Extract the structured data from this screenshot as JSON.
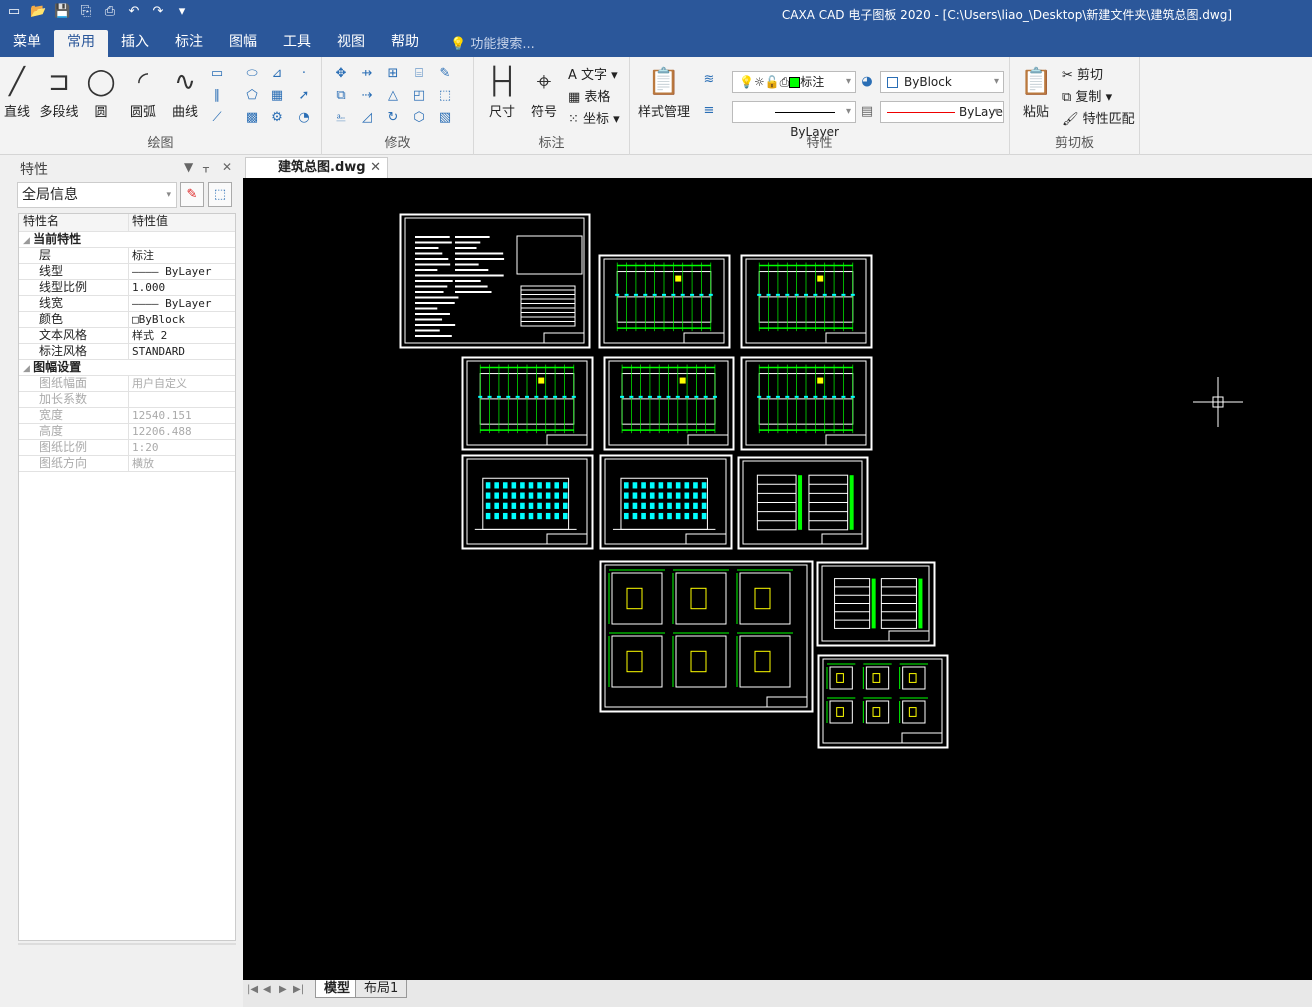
{
  "window": {
    "title": "CAXA CAD 电子图板 2020 - [C:\\Users\\liao_\\Desktop\\新建文件夹\\建筑总图.dwg]"
  },
  "quick_access": [
    "new-icon",
    "open-icon",
    "save-icon",
    "save-as-icon",
    "print-icon",
    "undo-icon",
    "redo-icon",
    "customize-icon"
  ],
  "menu_tabs": [
    "菜单",
    "常用",
    "插入",
    "标注",
    "图幅",
    "工具",
    "视图",
    "帮助"
  ],
  "active_tab": "常用",
  "search_placeholder": "功能搜索...",
  "ribbon": {
    "draw": {
      "label": "绘图",
      "line": "直线",
      "polyline": "多段线",
      "circle": "圆",
      "arc": "圆弧",
      "curve": "曲线"
    },
    "modify": {
      "label": "修改"
    },
    "annotate": {
      "label": "标注",
      "dimension": "尺寸",
      "symbol": "符号",
      "text": "文字",
      "table": "表格",
      "coordinate": "坐标"
    },
    "properties": {
      "label": "特性",
      "style_manager": "样式管理",
      "layer": "标注",
      "color": "ByBlock",
      "linetype": "ByLayer",
      "lineweight": "ByLayer"
    },
    "clipboard": {
      "label": "剪切板",
      "paste": "粘贴",
      "cut": "剪切",
      "copy": "复制",
      "match": "特性匹配"
    }
  },
  "panel": {
    "title": "特性",
    "selector": "全局信息",
    "col_name": "特性名",
    "col_value": "特性值",
    "cat1": "当前特性",
    "rows1": [
      [
        "层",
        "标注"
      ],
      [
        "线型",
        "———— ByLayer"
      ],
      [
        "线型比例",
        "1.000"
      ],
      [
        "线宽",
        "———— ByLayer"
      ],
      [
        "颜色",
        "□ByBlock"
      ],
      [
        "文本风格",
        "样式 2"
      ],
      [
        "标注风格",
        "STANDARD"
      ]
    ],
    "cat2": "图幅设置",
    "rows2": [
      [
        "图纸幅面",
        "用户自定义"
      ],
      [
        "加长系数",
        ""
      ],
      [
        "宽度",
        "12540.151"
      ],
      [
        "高度",
        "12206.488"
      ],
      [
        "图纸比例",
        "1:20"
      ],
      [
        "图纸方向",
        "横放"
      ]
    ]
  },
  "document_tab": "建筑总图.dwg",
  "layout_tabs": [
    "模型",
    "布局1"
  ],
  "colors": {
    "title_bar": "#2b579a",
    "canvas": "#000000",
    "frame": "#ffffff",
    "grid": "#00ff00",
    "window": "#00ffff",
    "highlight": "#ffff00"
  }
}
